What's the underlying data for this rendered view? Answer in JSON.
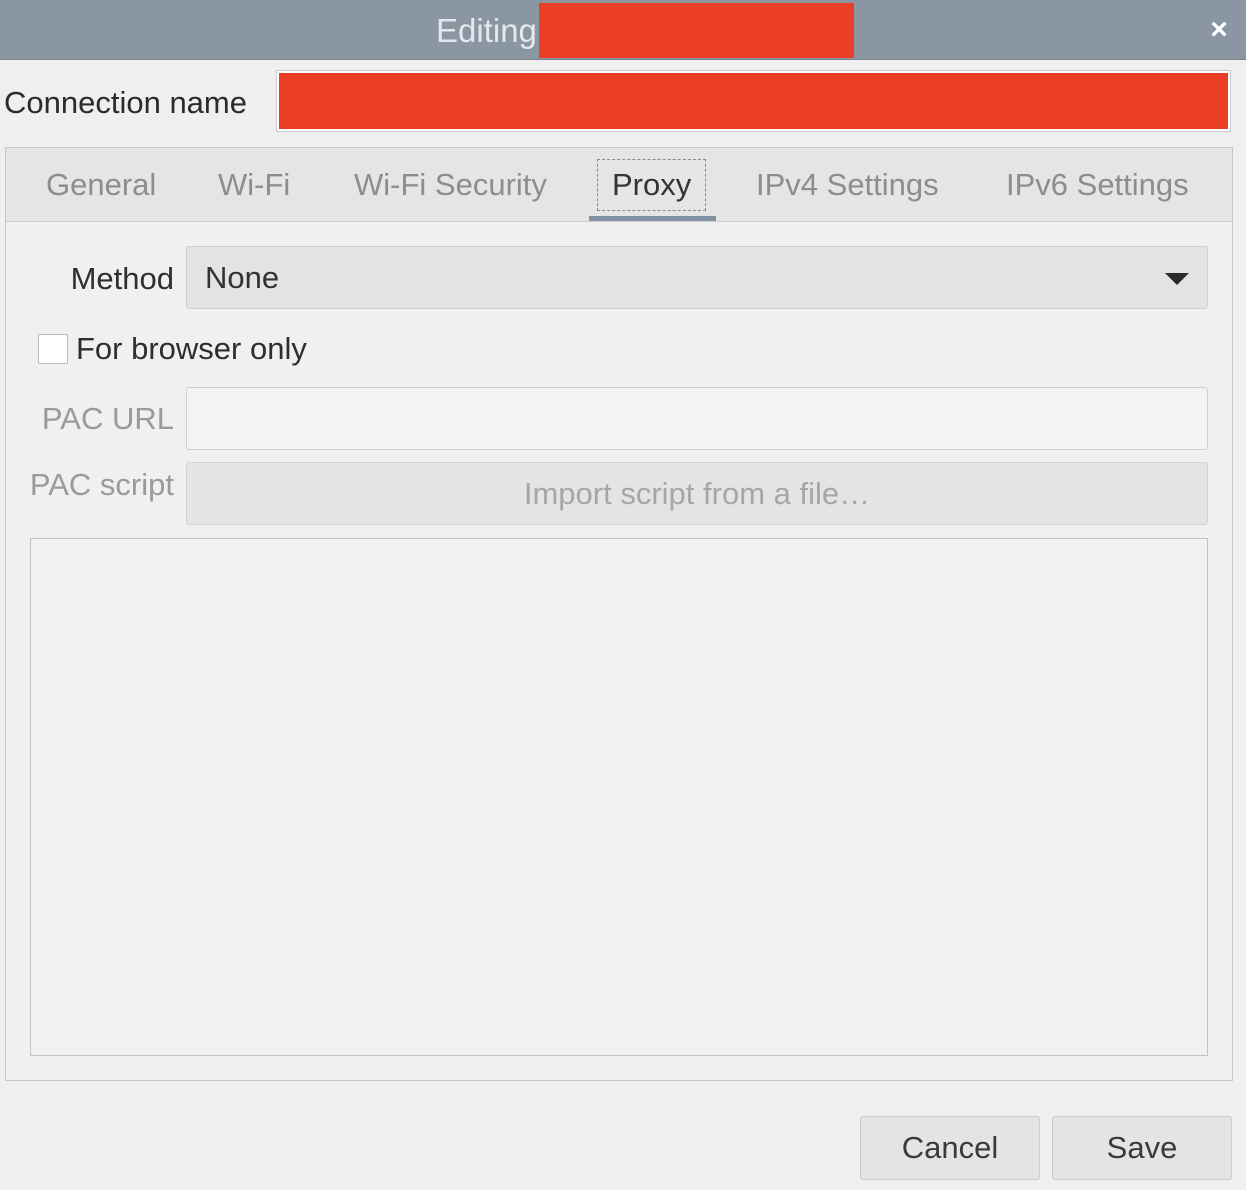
{
  "window": {
    "title": "Editing",
    "close_label": "×"
  },
  "connection": {
    "label": "Connection name",
    "value": ""
  },
  "tabs": [
    {
      "label": "General",
      "active": false
    },
    {
      "label": "Wi-Fi",
      "active": false
    },
    {
      "label": "Wi-Fi Security",
      "active": false
    },
    {
      "label": "Proxy",
      "active": true
    },
    {
      "label": "IPv4 Settings",
      "active": false
    },
    {
      "label": "IPv6 Settings",
      "active": false
    }
  ],
  "proxy": {
    "method_label": "Method",
    "method_value": "None",
    "browser_only_label": "For browser only",
    "browser_only_checked": false,
    "pac_url_label": "PAC URL",
    "pac_url_value": "",
    "pac_script_label": "PAC script",
    "import_label": "Import script from a file…",
    "script_text": ""
  },
  "buttons": {
    "cancel": "Cancel",
    "save": "Save"
  },
  "colors": {
    "titlebar": "#8a96a2",
    "redaction": "#ea3f26",
    "tab_indicator": "#8193a5"
  }
}
